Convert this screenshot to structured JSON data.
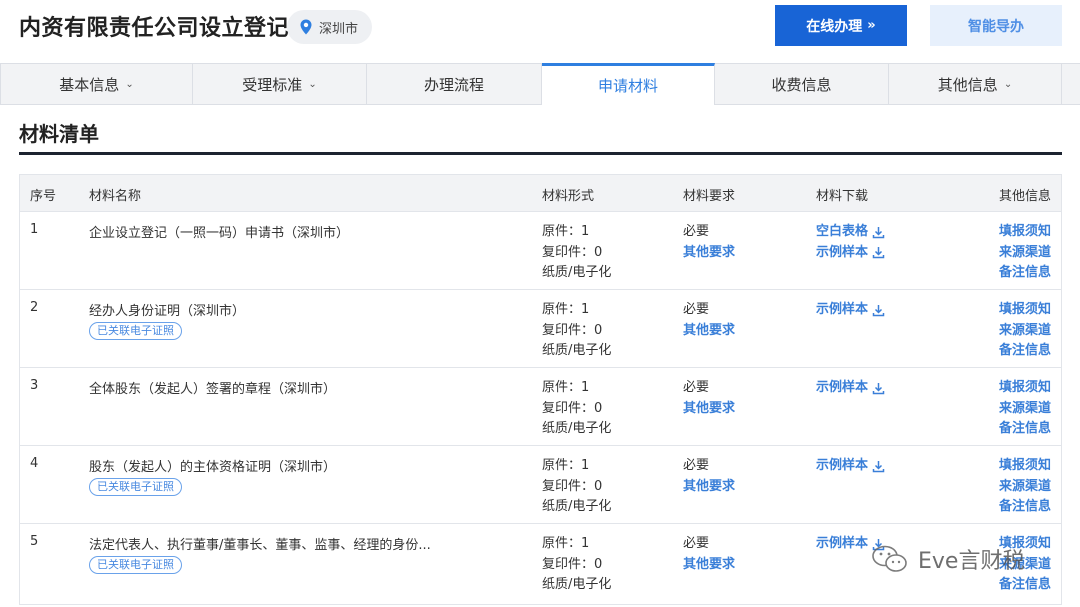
{
  "header": {
    "title": "内资有限责任公司设立登记",
    "location": "深圳市",
    "online_button": "在线办理",
    "online_chevron": "»",
    "guide_button": "智能导办"
  },
  "tabs": [
    {
      "label": "基本信息",
      "caret": "⌄"
    },
    {
      "label": "受理标准",
      "caret": "⌄"
    },
    {
      "label": "办理流程",
      "caret": ""
    },
    {
      "label": "申请材料",
      "caret": ""
    },
    {
      "label": "收费信息",
      "caret": ""
    },
    {
      "label": "其他信息",
      "caret": "⌄"
    }
  ],
  "active_tab": "申请材料",
  "section_title": "材料清单",
  "table": {
    "columns": [
      "序号",
      "材料名称",
      "材料形式",
      "材料要求",
      "材料下载",
      "其他信息"
    ],
    "rows": [
      {
        "num": "1",
        "name": "企业设立登记（一照一码）申请书（深圳市）",
        "badge": "",
        "form": [
          "原件：1",
          "复印件：0",
          "纸质/电子化"
        ],
        "req_must": "必要",
        "req_other": "其他要求",
        "downloads": [
          "空白表格",
          "示例样本"
        ],
        "other": [
          "填报须知",
          "来源渠道",
          "备注信息"
        ]
      },
      {
        "num": "2",
        "name": "经办人身份证明（深圳市）",
        "badge": "已关联电子证照",
        "form": [
          "原件：1",
          "复印件：0",
          "纸质/电子化"
        ],
        "req_must": "必要",
        "req_other": "其他要求",
        "downloads": [
          "示例样本"
        ],
        "other": [
          "填报须知",
          "来源渠道",
          "备注信息"
        ]
      },
      {
        "num": "3",
        "name": "全体股东（发起人）签署的章程（深圳市）",
        "badge": "",
        "form": [
          "原件：1",
          "复印件：0",
          "纸质/电子化"
        ],
        "req_must": "必要",
        "req_other": "其他要求",
        "downloads": [
          "示例样本"
        ],
        "other": [
          "填报须知",
          "来源渠道",
          "备注信息"
        ]
      },
      {
        "num": "4",
        "name": "股东（发起人）的主体资格证明（深圳市）",
        "badge": "已关联电子证照",
        "form": [
          "原件：1",
          "复印件：0",
          "纸质/电子化"
        ],
        "req_must": "必要",
        "req_other": "其他要求",
        "downloads": [
          "示例样本"
        ],
        "other": [
          "填报须知",
          "来源渠道",
          "备注信息"
        ]
      },
      {
        "num": "5",
        "name": "法定代表人、执行董事/董事长、董事、监事、经理的身份...",
        "badge": "已关联电子证照",
        "form": [
          "原件：1",
          "复印件：0",
          "纸质/电子化"
        ],
        "req_must": "必要",
        "req_other": "其他要求",
        "downloads": [
          "示例样本"
        ],
        "other": [
          "填报须知",
          "来源渠道",
          "备注信息"
        ]
      }
    ]
  },
  "watermark": "Eve言财税",
  "colors": {
    "primary": "#1864d6",
    "link": "#3a7fd8",
    "tab_active": "#2f7fe0",
    "guide_bg": "#e7f0fc",
    "rule": "#1c2330"
  },
  "icons": {
    "location": "map-pin-icon",
    "download": "download-icon",
    "watermark": "wechat-logo-icon"
  }
}
